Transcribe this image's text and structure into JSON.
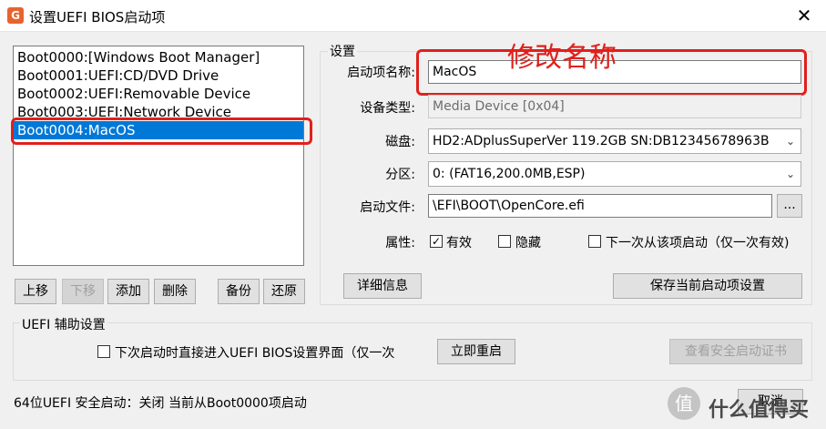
{
  "window": {
    "title": "设置UEFI BIOS启动项",
    "app_icon": "app-logo-icon",
    "close_icon": "close-icon"
  },
  "boot_list": {
    "items": [
      {
        "label": "Boot0000:[Windows Boot Manager]",
        "selected": false
      },
      {
        "label": "Boot0001:UEFI:CD/DVD Drive",
        "selected": false
      },
      {
        "label": "Boot0002:UEFI:Removable Device",
        "selected": false
      },
      {
        "label": "Boot0003:UEFI:Network Device",
        "selected": false
      },
      {
        "label": "Boot0004:MacOS",
        "selected": true
      }
    ]
  },
  "list_buttons": {
    "up": "上移",
    "down": "下移",
    "add": "添加",
    "delete": "删除",
    "backup": "备份",
    "restore": "还原"
  },
  "settings": {
    "group_title": "设置",
    "name_label": "启动项名称:",
    "name_value": "MacOS",
    "device_type_label": "设备类型:",
    "device_type_value": "Media Device [0x04]",
    "disk_label": "磁盘:",
    "disk_value": "HD2:ADplusSuperVer 119.2GB SN:DB12345678963B",
    "partition_label": "分区:",
    "partition_value": "0: (FAT16,200.0MB,ESP)",
    "boot_file_label": "启动文件:",
    "boot_file_value": "\\EFI\\BOOT\\OpenCore.efi",
    "browse_label": "...",
    "attr_label": "属性:",
    "attr_valid": "有效",
    "attr_hidden": "隐藏",
    "attr_next_once": "下一次从该项启动（仅一次有效)",
    "details_button": "详细信息",
    "save_button": "保存当前启动项设置"
  },
  "uefi_aux": {
    "group_title": "UEFI 辅助设置",
    "next_boot_label": "下次启动时直接进入UEFI BIOS设置界面（仅一次",
    "reboot_button": "立即重启",
    "secure_cert_button": "查看安全启动证书"
  },
  "status": {
    "text": "64位UEFI   安全启动：关闭   当前从Boot0000项启动"
  },
  "cancel_button": "取消",
  "annotation": {
    "text": "修改名称",
    "color": "#e0201c"
  },
  "watermark": {
    "icon": "zhi-icon",
    "text": "什么值得买"
  },
  "colors": {
    "selection": "#0078d7",
    "annotation_red": "#e0201c",
    "window_bg": "#f0f0f0"
  }
}
